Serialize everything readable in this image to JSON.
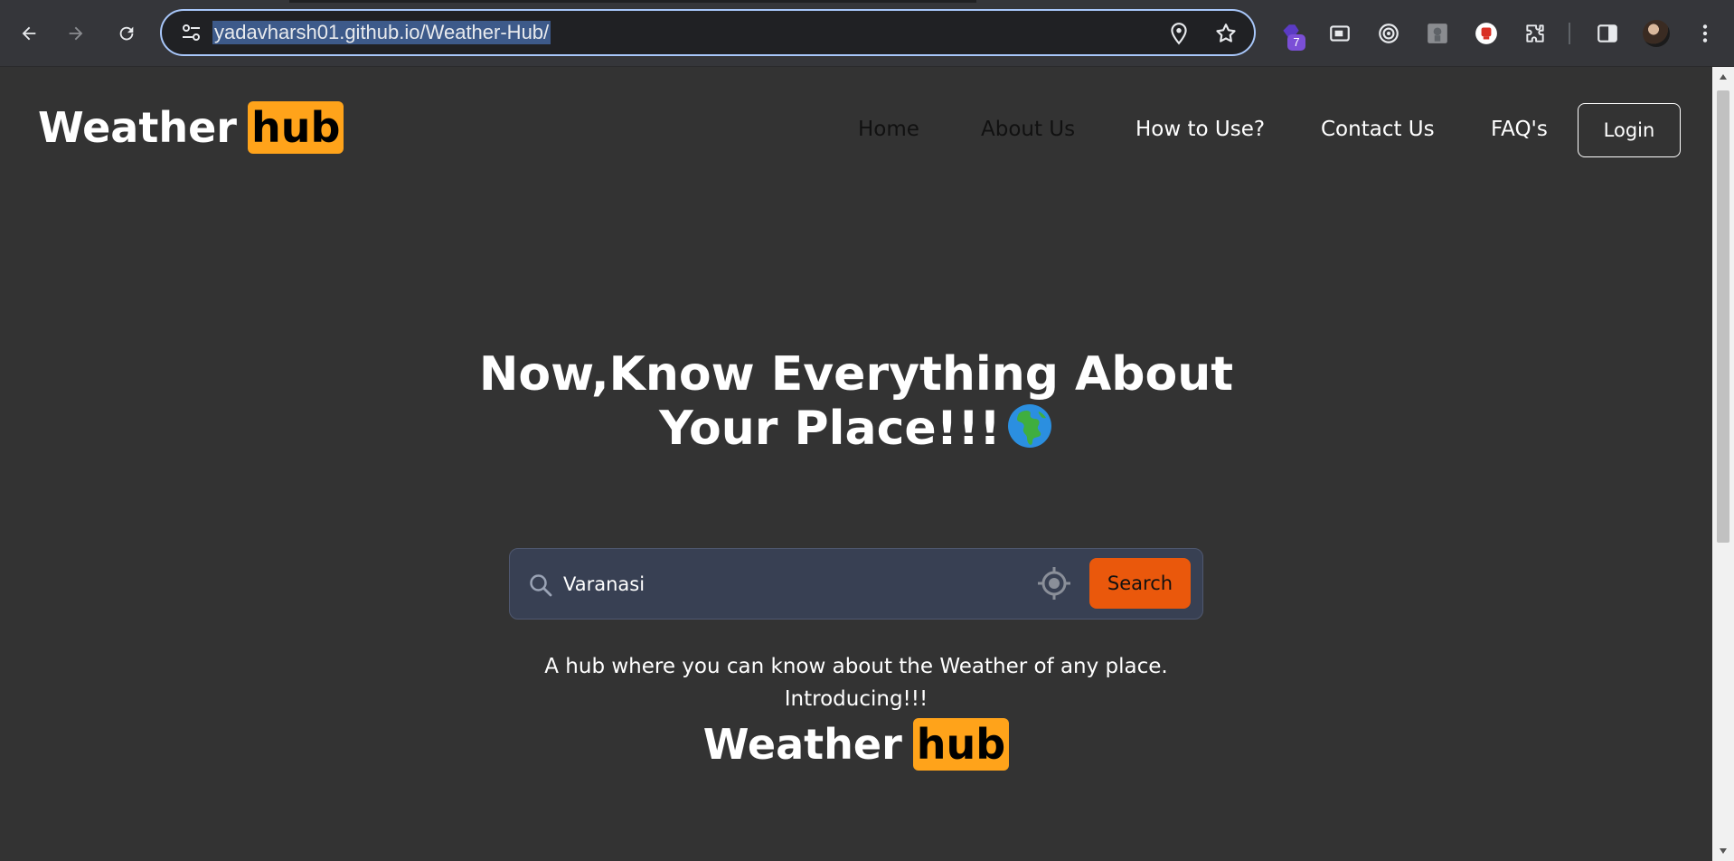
{
  "browser": {
    "url": "yadavharsh01.github.io/Weather-Hub/",
    "extension_badge": "7",
    "icons": [
      "back-arrow-icon",
      "forward-arrow-icon",
      "reload-icon",
      "site-settings-icon",
      "location-icon",
      "bookmark-star-icon",
      "extension-icon",
      "extensions-puzzle-icon",
      "side-panel-icon",
      "profile-avatar",
      "menu-dots-icon"
    ]
  },
  "site": {
    "logo": {
      "word": "Weather",
      "highlight": "hub"
    },
    "nav": [
      {
        "label": "Home"
      },
      {
        "label": "About Us"
      },
      {
        "label": "How to Use?"
      },
      {
        "label": "Contact Us"
      },
      {
        "label": "FAQ's"
      }
    ],
    "login_label": "Login"
  },
  "hero": {
    "title_line1": "Now,Know Everything About",
    "title_line2": "Your Place!!!",
    "search": {
      "value": "Varanasi",
      "button_label": "Search"
    },
    "tagline_line1": "A hub where you can know about the Weather of any place.",
    "tagline_line2": "Introducing!!!",
    "logo": {
      "word": "Weather",
      "highlight": "hub"
    }
  },
  "colors": {
    "page_bg": "#333333",
    "accent_orange": "#ffa31a",
    "search_button": "#ea580c",
    "search_box": "#384053"
  }
}
